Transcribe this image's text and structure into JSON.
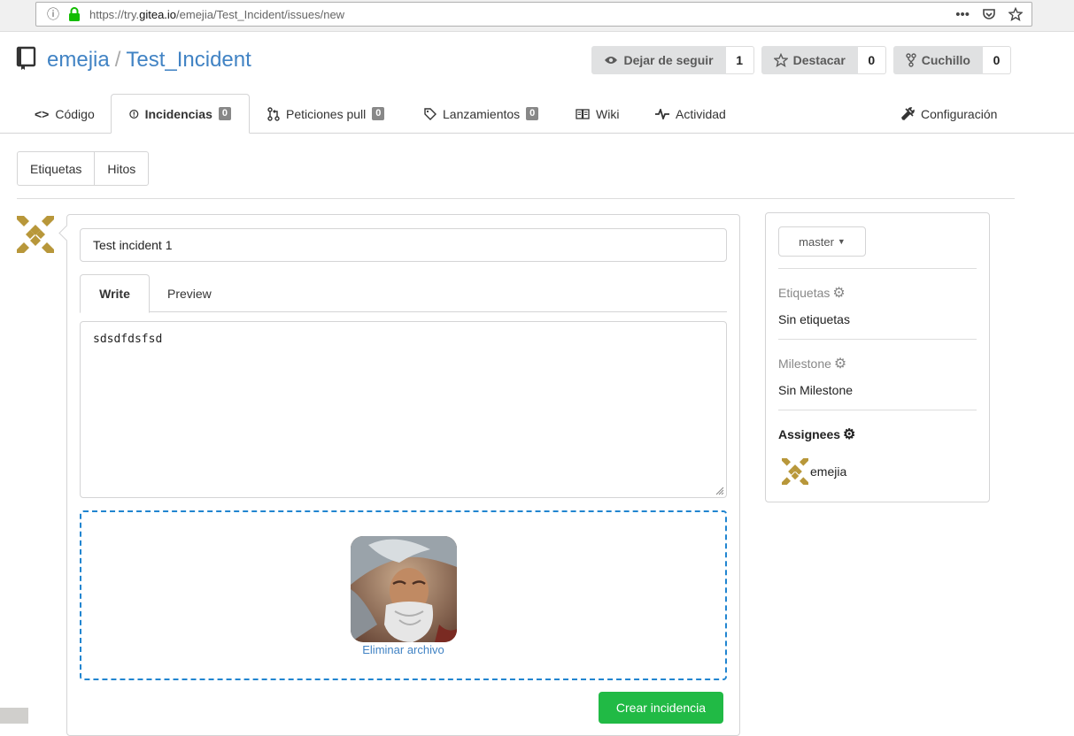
{
  "browser": {
    "url_prefix": "https://try.",
    "url_domain": "gitea.io",
    "url_path": "/emejia/Test_Incident/issues/new"
  },
  "repo": {
    "owner": "emejia",
    "separator": "/",
    "name": "Test_Incident",
    "actions": [
      {
        "label": "Dejar de seguir",
        "count": "1",
        "icon": "eye-icon"
      },
      {
        "label": "Destacar",
        "count": "0",
        "icon": "star-icon"
      },
      {
        "label": "Cuchillo",
        "count": "0",
        "icon": "fork-icon"
      }
    ]
  },
  "tabs": {
    "code": "Código",
    "issues": "Incidencias",
    "issues_count": "0",
    "pulls": "Peticiones pull",
    "pulls_count": "0",
    "releases": "Lanzamientos",
    "releases_count": "0",
    "wiki": "Wiki",
    "activity": "Actividad",
    "settings": "Configuración"
  },
  "filters": {
    "labels": "Etiquetas",
    "milestones": "Hitos"
  },
  "form": {
    "title_value": "Test incident 1",
    "write_tab": "Write",
    "preview_tab": "Preview",
    "body": "sdsdfdsfsd",
    "remove_file": "Eliminar archivo",
    "submit": "Crear incidencia"
  },
  "sidebar": {
    "branch": "master",
    "labels_heading": "Etiquetas",
    "labels_value": "Sin etiquetas",
    "milestone_heading": "Milestone",
    "milestone_value": "Sin Milestone",
    "assignees_heading": "Assignees",
    "assignee_name": "emejia"
  },
  "colors": {
    "link": "#4183c4",
    "success": "#21ba45",
    "dropzone_border": "#2185d0",
    "avatar_gold": "#b8973a"
  }
}
